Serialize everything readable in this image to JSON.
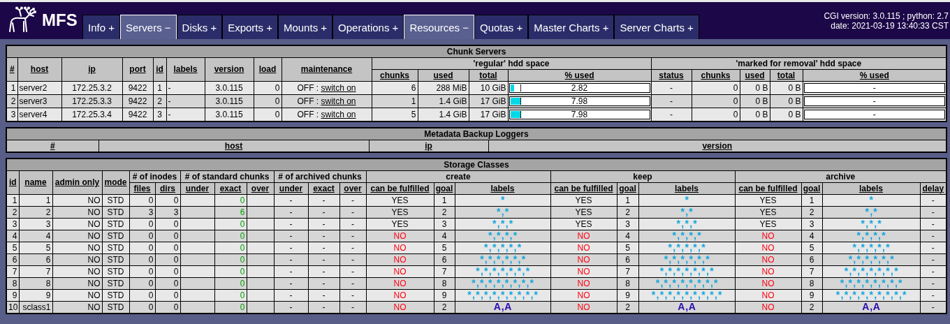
{
  "header": {
    "logo_text": "MFS",
    "tabs": [
      {
        "label": "Info +",
        "selected": false
      },
      {
        "label": "Servers −",
        "selected": true
      },
      {
        "label": "Disks +",
        "selected": false
      },
      {
        "label": "Exports +",
        "selected": false
      },
      {
        "label": "Mounts +",
        "selected": false
      },
      {
        "label": "Operations +",
        "selected": false
      },
      {
        "label": "Resources −",
        "selected": true
      },
      {
        "label": "Quotas +",
        "selected": false
      },
      {
        "label": "Master Charts +",
        "selected": false
      },
      {
        "label": "Server Charts +",
        "selected": false
      }
    ],
    "info_lines": [
      "CGI version: 3.0.115 ; python: 2.7",
      "date: 2021-03-19 13:40:33 CST"
    ]
  },
  "chunk_servers": {
    "title": "Chunk Servers",
    "columns": [
      "#",
      "host",
      "ip",
      "port",
      "id",
      "labels",
      "version",
      "load",
      "maintenance"
    ],
    "groups": [
      {
        "title": "'regular' hdd space",
        "columns": [
          "chunks",
          "used",
          "total",
          "% used"
        ]
      },
      {
        "title": "'marked for removal' hdd space",
        "columns": [
          "status",
          "chunks",
          "used",
          "total",
          "% used"
        ]
      }
    ],
    "rows": [
      {
        "num": "1",
        "host": "server2",
        "ip": "172.25.3.2",
        "port": "9422",
        "id": "1",
        "labels": "-",
        "version": "3.0.115",
        "load": "0",
        "maintenance": "OFF :",
        "maintenance_action": "switch on",
        "regular": {
          "chunks": "6",
          "used": "288 MiB",
          "total": "10 GiB",
          "usage": {
            "level": 0.0282,
            "reading": "2.82"
          },
          "average": {
            "level": 0.075
          }
        },
        "removal": {
          "status": "-",
          "chunks": "0",
          "used": "0 B",
          "total": "0 B",
          "percent": "-"
        }
      },
      {
        "num": "2",
        "host": "server3",
        "ip": "172.25.3.3",
        "port": "9422",
        "id": "2",
        "labels": "-",
        "version": "3.0.115",
        "load": "0",
        "maintenance": "OFF :",
        "maintenance_action": "switch on",
        "regular": {
          "chunks": "1",
          "used": "1.4 GiB",
          "total": "17 GiB",
          "usage": {
            "level": 0.0798,
            "reading": "7.98"
          },
          "average": {
            "level": 0.075
          }
        },
        "removal": {
          "status": "-",
          "chunks": "0",
          "used": "0 B",
          "total": "0 B",
          "percent": "-"
        }
      },
      {
        "num": "3",
        "host": "server4",
        "ip": "172.25.3.4",
        "port": "9422",
        "id": "3",
        "labels": "-",
        "version": "3.0.115",
        "load": "0",
        "maintenance": "OFF :",
        "maintenance_action": "switch on",
        "regular": {
          "chunks": "5",
          "used": "1.4 GiB",
          "total": "17 GiB",
          "usage": {
            "level": 0.0798,
            "reading": "7.98"
          },
          "average": {
            "level": 0.075
          }
        },
        "removal": {
          "status": "-",
          "chunks": "0",
          "used": "0 B",
          "total": "0 B",
          "percent": "-"
        }
      }
    ]
  },
  "metadata_loggers": {
    "title": "Metadata Backup Loggers",
    "columns": [
      "#",
      "host",
      "ip",
      "version"
    ]
  },
  "storage_classes": {
    "title": "Storage Classes",
    "columns": [
      "id",
      "name",
      "admin only",
      "mode"
    ],
    "groups": [
      {
        "title": "# of inodes",
        "columns": [
          "files",
          "dirs"
        ]
      },
      {
        "title": "# of standard chunks",
        "columns": [
          "under",
          "exact",
          "over"
        ]
      },
      {
        "title": "# of archived chunks",
        "columns": [
          "under",
          "exact",
          "over"
        ]
      },
      {
        "title": "create",
        "columns": [
          "can be fulfilled",
          "goal",
          "labels"
        ]
      },
      {
        "title": "keep",
        "columns": [
          "can be fulfilled",
          "goal",
          "labels"
        ]
      },
      {
        "title": "archive",
        "columns": [
          "can be fulfilled",
          "goal",
          "labels",
          "delay"
        ]
      }
    ],
    "rows": [
      {
        "id": "1",
        "name": "1",
        "admin_only": "NO",
        "mode": "STD",
        "files": "0",
        "dirs": "0",
        "std_exact": "0",
        "arch": [
          "-",
          "-",
          "-"
        ],
        "create": {
          "fulfilled": true,
          "text": "YES",
          "goal": "1",
          "labels": "*",
          "color": "#12a6dc"
        },
        "keep": {
          "fulfilled": true,
          "text": "YES",
          "goal": "1",
          "labels": "*",
          "color": "#12a6dc"
        },
        "archive": {
          "fulfilled": true,
          "text": "YES",
          "goal": "1",
          "labels": "*",
          "color": "#12a6dc"
        },
        "delay": "-"
      },
      {
        "id": "2",
        "name": "2",
        "admin_only": "NO",
        "mode": "STD",
        "files": "3",
        "dirs": "3",
        "std_exact": "6",
        "arch": [
          "-",
          "-",
          "-"
        ],
        "create": {
          "fulfilled": true,
          "text": "YES",
          "goal": "2",
          "labels": "* , *",
          "color": "#12a6dc"
        },
        "keep": {
          "fulfilled": true,
          "text": "YES",
          "goal": "2",
          "labels": "* , *",
          "color": "#12a6dc"
        },
        "archive": {
          "fulfilled": true,
          "text": "YES",
          "goal": "2",
          "labels": "* , *",
          "color": "#12a6dc"
        },
        "delay": "-"
      },
      {
        "id": "3",
        "name": "3",
        "admin_only": "NO",
        "mode": "STD",
        "files": "0",
        "dirs": "0",
        "std_exact": "0",
        "arch": [
          "-",
          "-",
          "-"
        ],
        "create": {
          "fulfilled": true,
          "text": "YES",
          "goal": "3",
          "labels": "* , * , *",
          "color": "#12a6dc"
        },
        "keep": {
          "fulfilled": true,
          "text": "YES",
          "goal": "3",
          "labels": "* , * , *",
          "color": "#12a6dc"
        },
        "archive": {
          "fulfilled": true,
          "text": "YES",
          "goal": "3",
          "labels": "* , * , *",
          "color": "#12a6dc"
        },
        "delay": "-"
      },
      {
        "id": "4",
        "name": "4",
        "admin_only": "NO",
        "mode": "STD",
        "files": "0",
        "dirs": "0",
        "std_exact": "0",
        "arch": [
          "-",
          "-",
          "-"
        ],
        "create": {
          "fulfilled": false,
          "text": "NO",
          "goal": "4",
          "labels": "* , * , * , *",
          "color": "#12a6dc"
        },
        "keep": {
          "fulfilled": false,
          "text": "NO",
          "goal": "4",
          "labels": "* , * , * , *",
          "color": "#12a6dc"
        },
        "archive": {
          "fulfilled": false,
          "text": "NO",
          "goal": "4",
          "labels": "* , * , * , *",
          "color": "#12a6dc"
        },
        "delay": "-"
      },
      {
        "id": "5",
        "name": "5",
        "admin_only": "NO",
        "mode": "STD",
        "files": "0",
        "dirs": "0",
        "std_exact": "0",
        "arch": [
          "-",
          "-",
          "-"
        ],
        "create": {
          "fulfilled": false,
          "text": "NO",
          "goal": "5",
          "labels": "* , * , * , * , *",
          "color": "#12a6dc"
        },
        "keep": {
          "fulfilled": false,
          "text": "NO",
          "goal": "5",
          "labels": "* , * , * , * , *",
          "color": "#12a6dc"
        },
        "archive": {
          "fulfilled": false,
          "text": "NO",
          "goal": "5",
          "labels": "* , * , * , * , *",
          "color": "#12a6dc"
        },
        "delay": "-"
      },
      {
        "id": "6",
        "name": "6",
        "admin_only": "NO",
        "mode": "STD",
        "files": "0",
        "dirs": "0",
        "std_exact": "0",
        "arch": [
          "-",
          "-",
          "-"
        ],
        "create": {
          "fulfilled": false,
          "text": "NO",
          "goal": "6",
          "labels": "* , * , * , * , * , *",
          "color": "#12a6dc"
        },
        "keep": {
          "fulfilled": false,
          "text": "NO",
          "goal": "6",
          "labels": "* , * , * , * , * , *",
          "color": "#12a6dc"
        },
        "archive": {
          "fulfilled": false,
          "text": "NO",
          "goal": "6",
          "labels": "* , * , * , * , * , *",
          "color": "#12a6dc"
        },
        "delay": "-"
      },
      {
        "id": "7",
        "name": "7",
        "admin_only": "NO",
        "mode": "STD",
        "files": "0",
        "dirs": "0",
        "std_exact": "0",
        "arch": [
          "-",
          "-",
          "-"
        ],
        "create": {
          "fulfilled": false,
          "text": "NO",
          "goal": "7",
          "labels": "* , * , * , * , * , * , *",
          "color": "#12a6dc"
        },
        "keep": {
          "fulfilled": false,
          "text": "NO",
          "goal": "7",
          "labels": "* , * , * , * , * , * , *",
          "color": "#12a6dc"
        },
        "archive": {
          "fulfilled": false,
          "text": "NO",
          "goal": "7",
          "labels": "* , * , * , * , * , * , *",
          "color": "#12a6dc"
        },
        "delay": "-"
      },
      {
        "id": "8",
        "name": "8",
        "admin_only": "NO",
        "mode": "STD",
        "files": "0",
        "dirs": "0",
        "std_exact": "0",
        "arch": [
          "-",
          "-",
          "-"
        ],
        "create": {
          "fulfilled": false,
          "text": "NO",
          "goal": "8",
          "labels": "* , * , * , * , * , * , * , *",
          "color": "#12a6dc"
        },
        "keep": {
          "fulfilled": false,
          "text": "NO",
          "goal": "8",
          "labels": "* , * , * , * , * , * , * , *",
          "color": "#12a6dc"
        },
        "archive": {
          "fulfilled": false,
          "text": "NO",
          "goal": "8",
          "labels": "* , * , * , * , * , * , * , *",
          "color": "#12a6dc"
        },
        "delay": "-"
      },
      {
        "id": "9",
        "name": "9",
        "admin_only": "NO",
        "mode": "STD",
        "files": "0",
        "dirs": "0",
        "std_exact": "0",
        "arch": [
          "-",
          "-",
          "-"
        ],
        "create": {
          "fulfilled": false,
          "text": "NO",
          "goal": "9",
          "labels": "* , * , * , * , * , * , * , * , *",
          "color": "#12a6dc"
        },
        "keep": {
          "fulfilled": false,
          "text": "NO",
          "goal": "9",
          "labels": "* , * , * , * , * , * , * , * , *",
          "color": "#12a6dc"
        },
        "archive": {
          "fulfilled": false,
          "text": "NO",
          "goal": "9",
          "labels": "* , * , * , * , * , * , * , * , *",
          "color": "#12a6dc"
        },
        "delay": "-"
      },
      {
        "id": "10",
        "name": "sclass1",
        "admin_only": "NO",
        "mode": "STD",
        "files": "0",
        "dirs": "0",
        "std_exact": "0",
        "arch": [
          "-",
          "-",
          "-"
        ],
        "create": {
          "fulfilled": false,
          "text": "NO",
          "goal": "2",
          "labels": "A , A",
          "color": "#2a0ab0"
        },
        "keep": {
          "fulfilled": false,
          "text": "NO",
          "goal": "2",
          "labels": "A , A",
          "color": "#2a0ab0"
        },
        "archive": {
          "fulfilled": false,
          "text": "NO",
          "goal": "2",
          "labels": "A , A",
          "color": "#2a0ab0"
        },
        "delay": "-"
      }
    ]
  }
}
